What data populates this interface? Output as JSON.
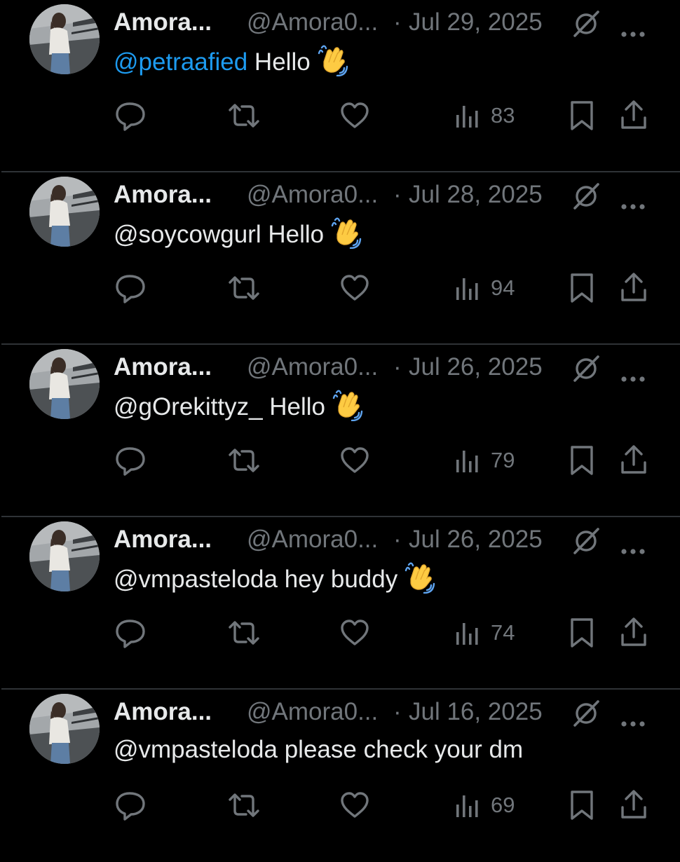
{
  "posts": [
    {
      "display_name": "Amora...",
      "handle": "@Amora0...",
      "separator": "·",
      "date": "Jul 29, 2025",
      "mention": "@petraafied",
      "text": " Hello",
      "mention_highlighted": true,
      "has_wave_emoji": true,
      "views": "83"
    },
    {
      "display_name": "Amora...",
      "handle": "@Amora0...",
      "separator": "·",
      "date": "Jul 28, 2025",
      "mention": "@soycowgurl",
      "text": " Hello",
      "mention_highlighted": false,
      "has_wave_emoji": true,
      "views": "94"
    },
    {
      "display_name": "Amora...",
      "handle": "@Amora0...",
      "separator": "·",
      "date": "Jul 26, 2025",
      "mention": "@gOrekittyz_",
      "text": " Hello",
      "mention_highlighted": false,
      "has_wave_emoji": true,
      "views": "79"
    },
    {
      "display_name": "Amora...",
      "handle": "@Amora0...",
      "separator": "·",
      "date": "Jul 26, 2025",
      "mention": "@vmpasteloda",
      "text": " hey buddy",
      "mention_highlighted": false,
      "has_wave_emoji": true,
      "views": "74"
    },
    {
      "display_name": "Amora...",
      "handle": "@Amora0...",
      "separator": "·",
      "date": "Jul 16, 2025",
      "mention": "@vmpasteloda",
      "text": " please check your dm",
      "mention_highlighted": false,
      "has_wave_emoji": false,
      "views": "69"
    }
  ],
  "icons": {
    "reply": "reply-icon",
    "retweet": "retweet-icon",
    "like": "heart-icon",
    "views": "views-chart-icon",
    "bookmark": "bookmark-icon",
    "share": "share-icon",
    "grok": "grok-icon",
    "more": "more-dots-icon",
    "wave": "waving-hand-icon"
  },
  "colors": {
    "background": "#000000",
    "primary_text": "#e7e9ea",
    "secondary_text": "#71767b",
    "mention_blue": "#1d9bf0",
    "divider": "#2f3336"
  }
}
